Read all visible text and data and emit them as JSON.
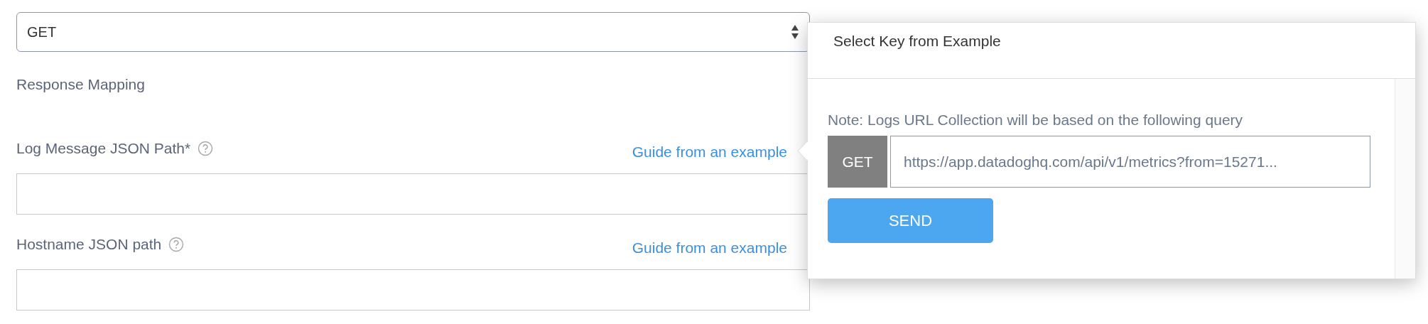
{
  "method_select": {
    "value": "GET"
  },
  "section_title": "Response Mapping",
  "fields": [
    {
      "label": "Log Message JSON Path*",
      "guide_link": "Guide from an example"
    },
    {
      "label": "Hostname JSON path",
      "guide_link": "Guide from an example"
    }
  ],
  "popover": {
    "title": "Select Key from Example",
    "note": "Note: Logs URL Collection will be based on the following query",
    "method": "GET",
    "url": "https://app.datadoghq.com/api/v1/metrics?from=15271...",
    "send_button": "SEND"
  }
}
